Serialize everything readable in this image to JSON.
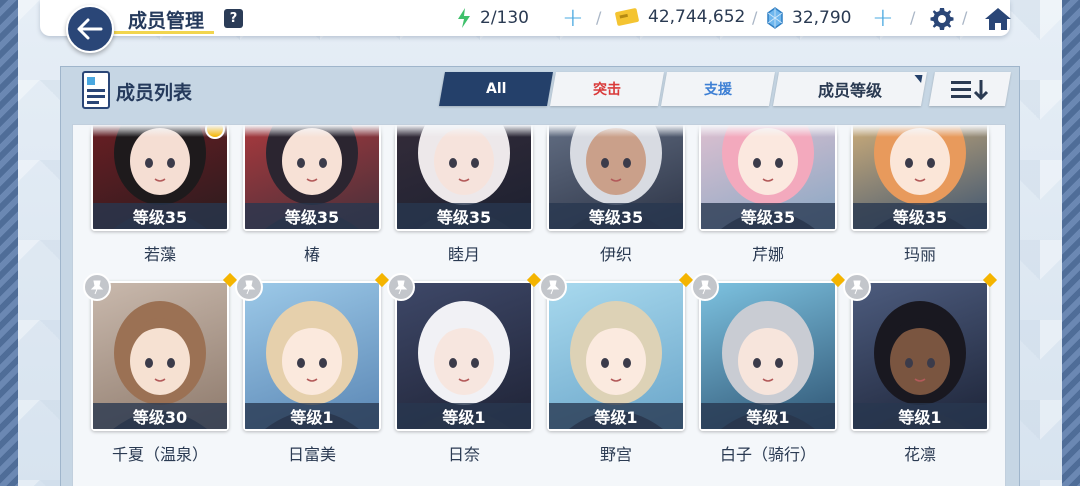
{
  "header": {
    "title": "成员管理",
    "help": "?",
    "ap": "2/130",
    "credits": "42,744,652",
    "pyroxene": "32,790"
  },
  "panel": {
    "title": "成员列表",
    "tabs": [
      {
        "label": "All",
        "color": "#ffffff"
      },
      {
        "label": "突击",
        "color": "#d93a3a"
      },
      {
        "label": "支援",
        "color": "#3d7fd4"
      }
    ],
    "sort_label": "成员等级"
  },
  "students": [
    {
      "name": "若藻",
      "level": "等级35",
      "bg1": "#7a1f25",
      "bg2": "#2a1b1e",
      "hair": "#1e1a1c",
      "skin": "#f5ded3",
      "badge": true
    },
    {
      "name": "椿",
      "level": "等级35",
      "bg1": "#c23b3e",
      "bg2": "#45303a",
      "hair": "#2b2530",
      "skin": "#f7e1d6",
      "badge": false
    },
    {
      "name": "睦月",
      "level": "等级35",
      "bg1": "#3a2f3c",
      "bg2": "#1c2030",
      "hair": "#ede8ea",
      "skin": "#f6e3dc",
      "badge": false
    },
    {
      "name": "伊织",
      "level": "等级35",
      "bg1": "#6f7c92",
      "bg2": "#2d3446",
      "hair": "#d8dbe2",
      "skin": "#caa08a",
      "badge": false
    },
    {
      "name": "芹娜",
      "level": "等级35",
      "bg1": "#f3c6d3",
      "bg2": "#87a7c4",
      "hair": "#f3a9bd",
      "skin": "#fbe8df",
      "badge": false
    },
    {
      "name": "玛丽",
      "level": "等级35",
      "bg1": "#f0c27b",
      "bg2": "#3c5471",
      "hair": "#e89a5c",
      "skin": "#fbe6d8",
      "badge": false
    },
    {
      "name": "千夏（温泉）",
      "level": "等级30",
      "bg1": "#c9b9ad",
      "bg2": "#8e7a6c",
      "hair": "#9b7154",
      "skin": "#f6e1d2",
      "badge": false
    },
    {
      "name": "日富美",
      "level": "等级1",
      "bg1": "#9cc9e8",
      "bg2": "#5a86b4",
      "hair": "#e6d0ac",
      "skin": "#fbe9dd",
      "badge": false
    },
    {
      "name": "日奈",
      "level": "等级1",
      "bg1": "#3e4868",
      "bg2": "#1f2336",
      "hair": "#f1f1f5",
      "skin": "#f7e6df",
      "badge": false
    },
    {
      "name": "野宫",
      "level": "等级1",
      "bg1": "#a8d9ee",
      "bg2": "#6aa5c9",
      "hair": "#ddd2b6",
      "skin": "#fbeadf",
      "badge": false
    },
    {
      "name": "白子（骑行）",
      "level": "等级1",
      "bg1": "#7dc2e0",
      "bg2": "#2f5574",
      "hair": "#c9ccd3",
      "skin": "#f7e5dc",
      "badge": false
    },
    {
      "name": "花凛",
      "level": "等级1",
      "bg1": "#4d5c7e",
      "bg2": "#1d2438",
      "hair": "#191820",
      "skin": "#7a5540",
      "badge": false
    }
  ]
}
